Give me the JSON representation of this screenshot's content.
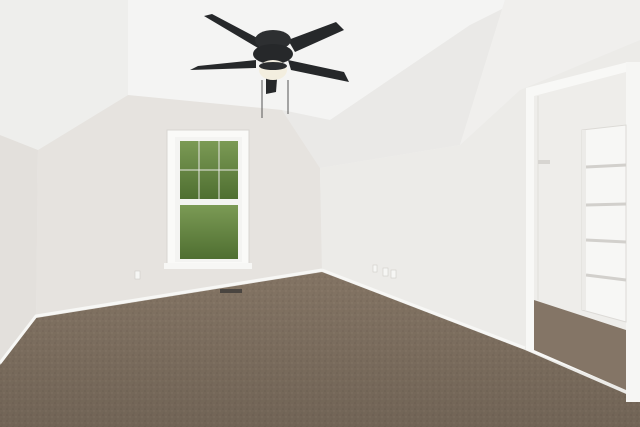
{
  "scene": {
    "colors": {
      "ceiling": "#f2f2f1",
      "ceiling_slope_left": "#eeeeec",
      "ceiling_slope_right": "#e9e8e6",
      "wall_back": "#e6e3df",
      "wall_right": "#ecebe8",
      "wall_left": "#e3e0dc",
      "carpet": "#8a7a69",
      "trim": "#f7f7f5",
      "fan_metal": "#26282a",
      "window_foliage": "#5f7f3e",
      "closet_interior": "#eeedea"
    },
    "objects": [
      "ceiling-fan-with-light",
      "double-hung-window",
      "closet-doorway",
      "closet-shelving",
      "floor-vent",
      "wall-outlets",
      "carpet-floor"
    ]
  }
}
